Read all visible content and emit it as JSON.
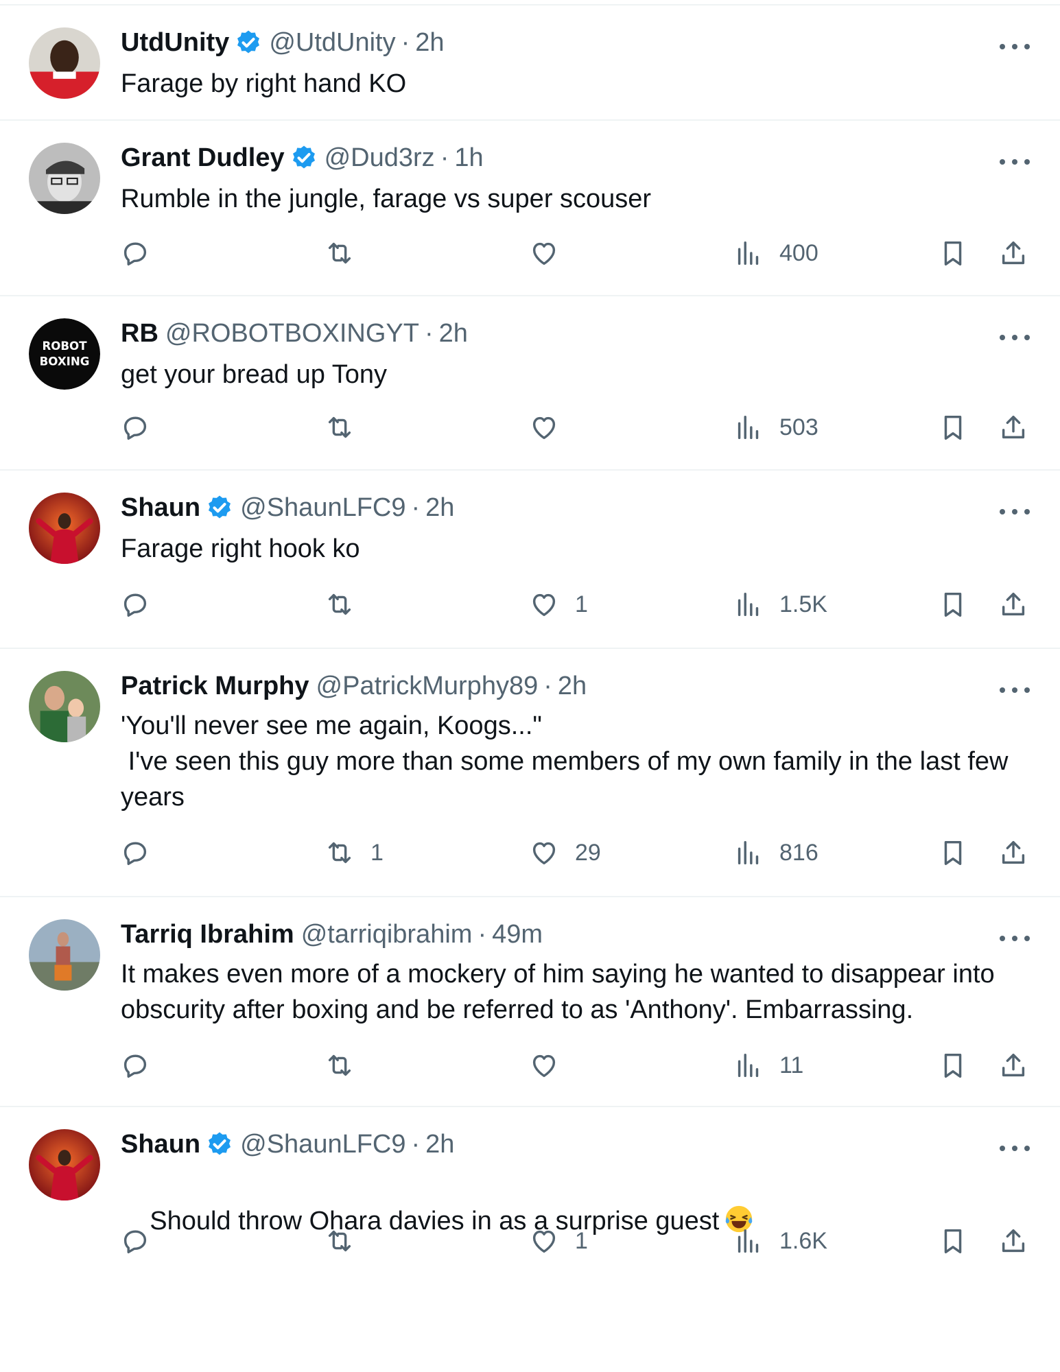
{
  "tweets": [
    {
      "name": "UtdUnity",
      "verified": true,
      "handle": "@UtdUnity",
      "time": "2h",
      "text": "Farage by right hand KO",
      "has_actions": false
    },
    {
      "name": "Grant Dudley",
      "verified": true,
      "handle": "@Dud3rz",
      "time": "1h",
      "text": "Rumble in the jungle, farage vs super scouser",
      "has_actions": true,
      "replies": "",
      "retweets": "",
      "likes": "",
      "views": "400"
    },
    {
      "name": "RB",
      "verified": false,
      "handle": "@ROBOTBOXINGYT",
      "time": "2h",
      "text": "get your bread up Tony",
      "avatar_text": [
        "ROBOT",
        "BOXING"
      ],
      "has_actions": true,
      "replies": "",
      "retweets": "",
      "likes": "",
      "views": "503"
    },
    {
      "name": "Shaun",
      "verified": true,
      "handle": "@ShaunLFC9",
      "time": "2h",
      "text": "Farage right hook ko",
      "has_actions": true,
      "replies": "",
      "retweets": "",
      "likes": "1",
      "views": "1.5K"
    },
    {
      "name": "Patrick Murphy",
      "verified": false,
      "handle": "@PatrickMurphy89",
      "time": "2h",
      "text": "'You'll never see me again, Koogs...\"\n I've seen this guy more than some members of my own family in the last few years",
      "has_actions": true,
      "replies": "",
      "retweets": "1",
      "likes": "29",
      "views": "816"
    },
    {
      "name": "Tarriq Ibrahim",
      "verified": false,
      "handle": "@tarriqibrahim",
      "time": "49m",
      "text": "It makes even more of a mockery of him saying he wanted to disappear into obscurity after boxing and be referred to as 'Anthony'. Embarrassing.",
      "has_actions": true,
      "replies": "",
      "retweets": "",
      "likes": "",
      "views": "11"
    },
    {
      "name": "Shaun",
      "verified": true,
      "handle": "@ShaunLFC9",
      "time": "2h",
      "text": "Should throw Ohara davies in as a surprise guest",
      "has_emoji": true,
      "has_actions": true,
      "replies": "",
      "retweets": "",
      "likes": "1",
      "views": "1.6K"
    }
  ],
  "icons": {
    "reply": "reply-icon",
    "retweet": "retweet-icon",
    "like": "like-icon",
    "views": "views-icon",
    "bookmark": "bookmark-icon",
    "share": "share-icon",
    "verified": "verified-badge-icon",
    "more": "more-options-icon"
  },
  "colors": {
    "verified_blue": "#1d9bf0",
    "secondary_text": "#536471",
    "border": "#eff3f4"
  }
}
